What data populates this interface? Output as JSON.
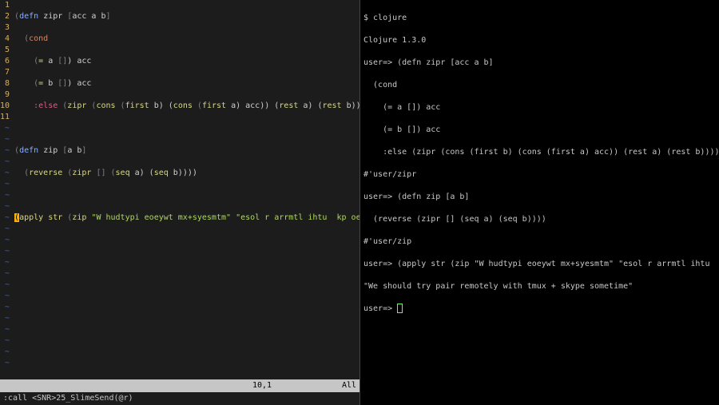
{
  "editor": {
    "lines": [
      "1",
      "2",
      "3",
      "4",
      "5",
      "6",
      "7",
      "8",
      "9",
      "10",
      "11"
    ],
    "l1": {
      "a": "(",
      "b": "defn",
      "c": " zipr ",
      "d": "[",
      "e": "acc a b",
      "f": "]"
    },
    "l2": {
      "a": "  (",
      "b": "cond"
    },
    "l3": {
      "a": "    (",
      "b": "=",
      "c": " a ",
      "d": "[]",
      "e": ") acc"
    },
    "l4": {
      "a": "    (",
      "b": "=",
      "c": " b ",
      "d": "[]",
      "e": ") acc"
    },
    "l5": {
      "a": "    ",
      "b": ":else",
      "c": " (",
      "d": "zipr",
      "e": " (",
      "f": "cons",
      "g": " (",
      "h": "first",
      "i": " b) (",
      "j": "cons",
      "k": " (",
      "l": "first",
      "m": " a) acc)) (",
      "n": "rest",
      "o": " a) (",
      "p": "rest",
      "q": " b))))"
    },
    "l7": {
      "a": "(",
      "b": "defn",
      "c": " zip ",
      "d": "[",
      "e": "a b",
      "f": "]"
    },
    "l8": {
      "a": "  (",
      "b": "reverse",
      "c": " (",
      "d": "zipr",
      "e": " ",
      "f": "[]",
      "g": " (",
      "h": "seq",
      "i": " a) (",
      "j": "seq",
      "k": " b))))"
    },
    "l10": {
      "a": "(",
      "b": "apply",
      "c": " ",
      "d": "str",
      "e": " (",
      "f": "zip",
      "g": " ",
      "h": "\"W hudtypi eoeywt mx+syesmtm\"",
      "i": " ",
      "j": "\"esol r arrmtl ihtu  kp oeie\"",
      "k": "))"
    }
  },
  "status": {
    "left": "",
    "mid": "10,1",
    "right": "All"
  },
  "cmd": ":call <SNR>25_SlimeSend(@r)",
  "repl": {
    "r1": "$ clojure",
    "r2": "Clojure 1.3.0",
    "r3": "user=> (defn zipr [acc a b]",
    "r4": "  (cond",
    "r5": "    (= a []) acc",
    "r6": "    (= b []) acc",
    "r7": "    :else (zipr (cons (first b) (cons (first a) acc)) (rest a) (rest b))))",
    "r8": "#'user/zipr",
    "r9": "user=> (defn zip [a b]",
    "r10": "  (reverse (zipr [] (seq a) (seq b))))",
    "r11": "#'user/zip",
    "r12": "user=> (apply str (zip \"W hudtypi eoeywt mx+syesmtm\" \"esol r arrmtl ihtu  kp oeie\"))",
    "r13": "\"We should try pair remotely with tmux + skype sometime\"",
    "r14": "user=> "
  }
}
